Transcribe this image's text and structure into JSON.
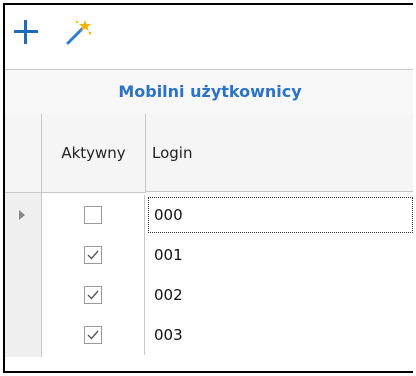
{
  "toolbar": {
    "add_icon": "plus-icon",
    "wand_icon": "magic-wand-icon",
    "accent_color": "#1f6bb8"
  },
  "grid": {
    "title": "Mobilni użytkownicy",
    "columns": [
      "Aktywny",
      "Login"
    ],
    "rows": [
      {
        "active": false,
        "login": "000"
      },
      {
        "active": true,
        "login": "001"
      },
      {
        "active": true,
        "login": "002"
      },
      {
        "active": true,
        "login": "003"
      }
    ],
    "current_row": 0
  }
}
